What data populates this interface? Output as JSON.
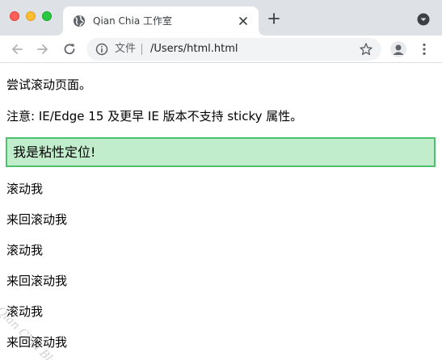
{
  "browser": {
    "tab_title": "Qian Chia 工作室",
    "address_label": "文件",
    "address_url": "/Users/html.html"
  },
  "page": {
    "intro": "尝试滚动页面。",
    "note": "注意: IE/Edge 15 及更早 IE 版本不支持 sticky 属性。",
    "sticky_text": "我是粘性定位!",
    "scroll_items": [
      "滚动我",
      "来回滚动我",
      "滚动我",
      "来回滚动我",
      "滚动我",
      "来回滚动我"
    ],
    "watermark": "Qian Chia Blog"
  },
  "colors": {
    "tabstrip_bg": "#dee1e6",
    "sticky_bg": "#c2edcc",
    "sticky_border": "#4cc26f",
    "close_red": "#ff5f57",
    "minimize_yellow": "#febc2e",
    "zoom_green": "#28c840"
  },
  "icons": [
    "close-window-icon",
    "minimize-window-icon",
    "zoom-window-icon",
    "globe-favicon-icon",
    "tab-close-icon",
    "new-tab-icon",
    "tab-menu-icon",
    "back-arrow-icon",
    "forward-arrow-icon",
    "reload-icon",
    "info-icon",
    "bookmark-star-icon",
    "profile-avatar-icon",
    "more-menu-icon"
  ]
}
